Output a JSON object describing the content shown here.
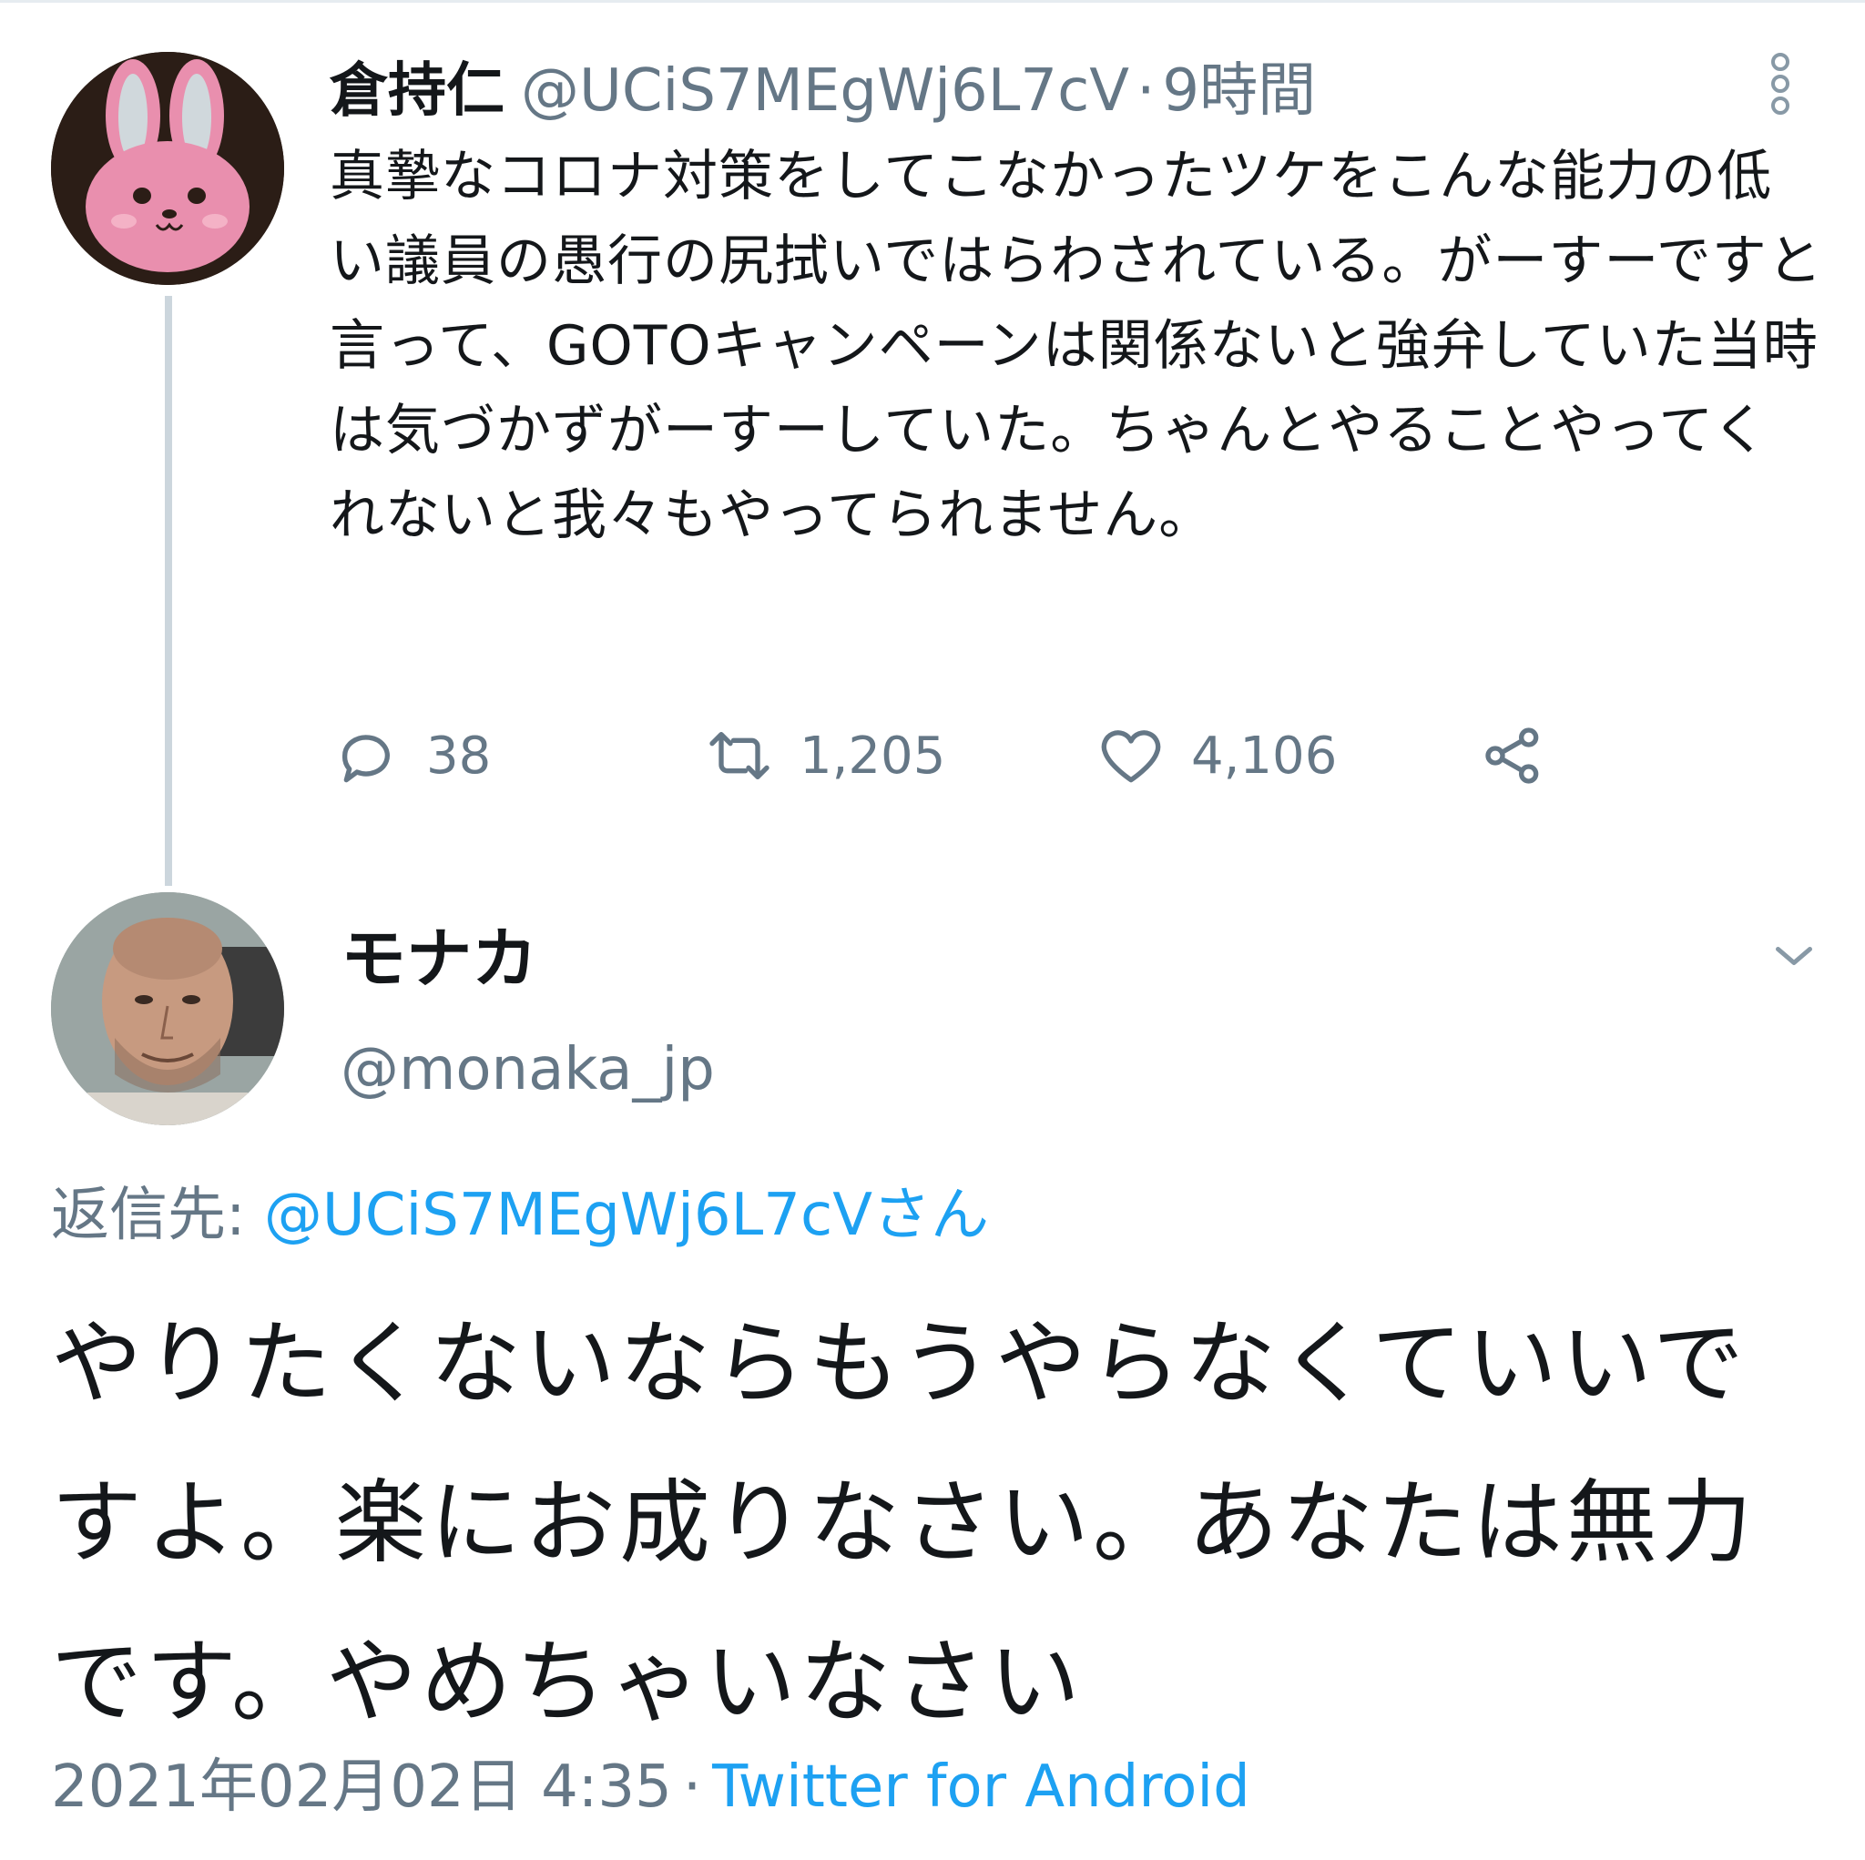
{
  "parent_tweet": {
    "display_name": "倉持仁",
    "handle": "@UCiS7MEgWj6L7cV",
    "separator": "·",
    "time_ago": "9時間",
    "text": "真摯なコロナ対策をしてこなかったツケをこんな能力の低い議員の愚行の尻拭いではらわされている。がーすーですと言って、GOTOキャンペーンは関係ないと強弁していた当時は気づかずがーすーしていた。ちゃんとやることやってくれないと我々もやってられません。",
    "actions": {
      "reply_count": "38",
      "retweet_count": "1,205",
      "like_count": "4,106"
    },
    "icons": [
      "more-vertical-icon",
      "reply-icon",
      "retweet-icon",
      "like-icon",
      "share-icon"
    ]
  },
  "reply_tweet": {
    "display_name": "モナカ",
    "handle": "@monaka_jp",
    "replying_label": "返信先: ",
    "replying_to": "@UCiS7MEgWj6L7cVさん",
    "text": "やりたくないならもうやらなくていいですよ。楽にお成りなさい。あなたは無力です。やめちゃいなさい",
    "timestamp": "2021年02月02日 4:35",
    "separator": "·",
    "source": "Twitter for Android",
    "icons": [
      "chevron-down-icon"
    ]
  },
  "colors": {
    "text_primary": "#14171a",
    "text_secondary": "#657786",
    "link": "#1da1f2",
    "thread_line": "#ccd6dd"
  }
}
